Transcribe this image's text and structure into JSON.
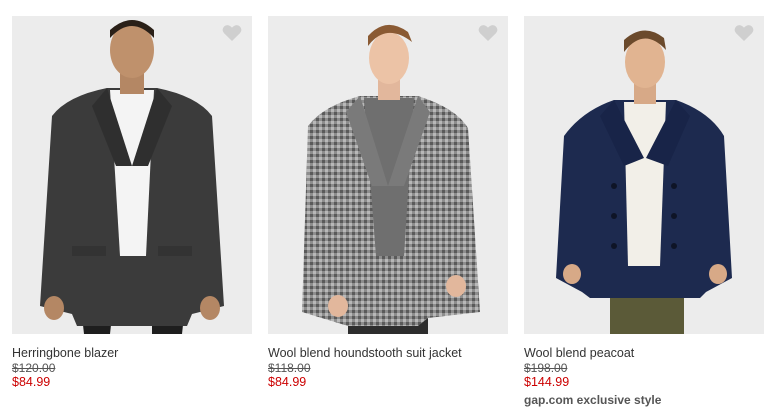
{
  "products": [
    {
      "name": "Herringbone blazer",
      "was_price": "$120.00",
      "sale_price": "$84.99",
      "badge": "",
      "favorite_icon": "heart-icon",
      "colors": {
        "sale": "#cc0000"
      }
    },
    {
      "name": "Wool blend houndstooth suit jacket",
      "was_price": "$118.00",
      "sale_price": "$84.99",
      "badge": "",
      "favorite_icon": "heart-icon",
      "colors": {
        "sale": "#cc0000"
      }
    },
    {
      "name": "Wool blend peacoat",
      "was_price": "$198.00",
      "sale_price": "$144.99",
      "badge": "gap.com exclusive style",
      "favorite_icon": "heart-icon",
      "colors": {
        "sale": "#cc0000"
      }
    }
  ]
}
